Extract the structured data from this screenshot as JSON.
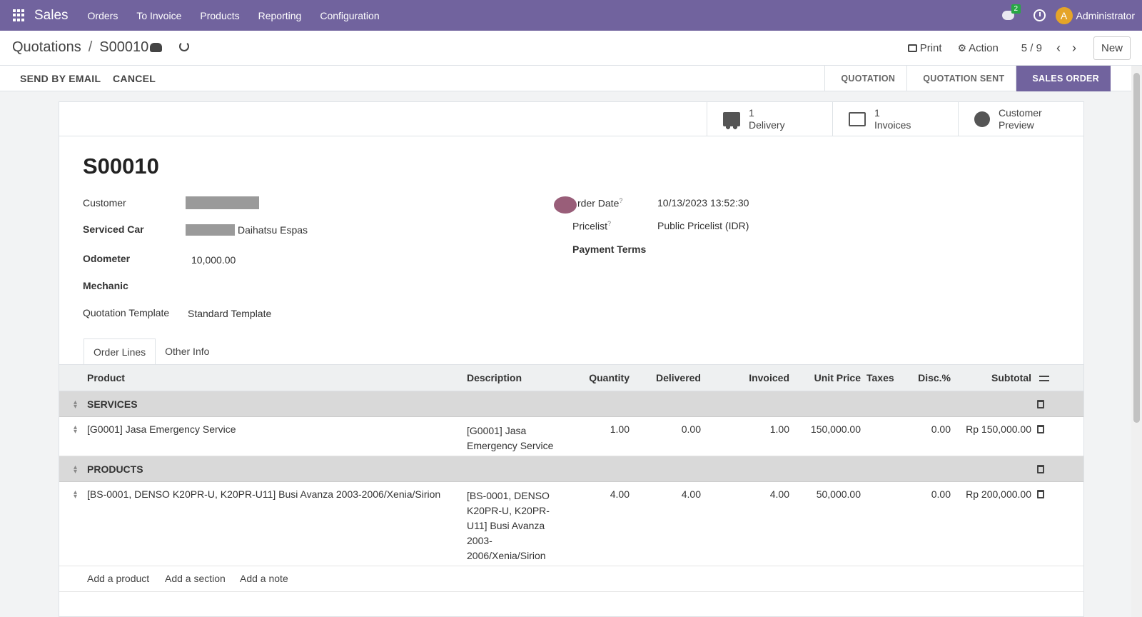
{
  "navbar": {
    "brand": "Sales",
    "menu": [
      "Orders",
      "To Invoice",
      "Products",
      "Reporting",
      "Configuration"
    ],
    "chat_badge": "2",
    "avatar_letter": "A",
    "user": "Administrator"
  },
  "control": {
    "breadcrumb_parent": "Quotations",
    "breadcrumb_sep": "/",
    "breadcrumb_current": "S00010",
    "print_label": "Print",
    "action_label": "Action",
    "pager": "5 / 9",
    "new_label": "New"
  },
  "statusbar": {
    "send_email": "SEND BY EMAIL",
    "cancel": "CANCEL",
    "stages": [
      "QUOTATION",
      "QUOTATION SENT",
      "SALES ORDER"
    ],
    "active_stage": "SALES ORDER"
  },
  "smart_buttons": {
    "delivery_count": "1",
    "delivery_label": "Delivery",
    "invoices_count": "1",
    "invoices_label": "Invoices",
    "preview_line1": "Customer",
    "preview_line2": "Preview"
  },
  "form": {
    "title": "S00010",
    "customer_label": "Customer",
    "serviced_car_label": "Serviced Car",
    "serviced_car_value": "Daihatsu Espas",
    "odometer_label": "Odometer",
    "odometer_value": "10,000.00",
    "mechanic_label": "Mechanic",
    "template_label": "Quotation Template",
    "template_value": "Standard Template",
    "order_date_label": "rder Date",
    "order_date_value": "10/13/2023 13:52:30",
    "pricelist_label": "Pricelist",
    "pricelist_value": "Public Pricelist (IDR)",
    "payment_terms_label": "Payment Terms",
    "help_mark": "?"
  },
  "tabs": [
    "Order Lines",
    "Other Info"
  ],
  "table": {
    "headers": {
      "product": "Product",
      "description": "Description",
      "quantity": "Quantity",
      "delivered": "Delivered",
      "invoiced": "Invoiced",
      "unit_price": "Unit Price",
      "taxes": "Taxes",
      "disc": "Disc.%",
      "subtotal": "Subtotal"
    },
    "sections": [
      {
        "name": "SERVICES",
        "line": {
          "product": "[G0001] Jasa Emergency Service",
          "description": [
            "[G0001] Jasa",
            "Emergency Service"
          ],
          "quantity": "1.00",
          "delivered": "0.00",
          "invoiced": "1.00",
          "unit_price": "150,000.00",
          "disc": "0.00",
          "subtotal": "Rp 150,000.00"
        }
      },
      {
        "name": "PRODUCTS",
        "line": {
          "product": "[BS-0001, DENSO K20PR-U, K20PR-U11] Busi Avanza 2003-2006/Xenia/Sirion",
          "description": [
            "[BS-0001, DENSO",
            "K20PR-U, K20PR-",
            "U11] Busi Avanza",
            "2003-",
            "2006/Xenia/Sirion"
          ],
          "quantity": "4.00",
          "delivered": "4.00",
          "invoiced": "4.00",
          "unit_price": "50,000.00",
          "disc": "0.00",
          "subtotal": "Rp 200,000.00"
        }
      }
    ],
    "add_links": [
      "Add a product",
      "Add a section",
      "Add a note"
    ]
  }
}
